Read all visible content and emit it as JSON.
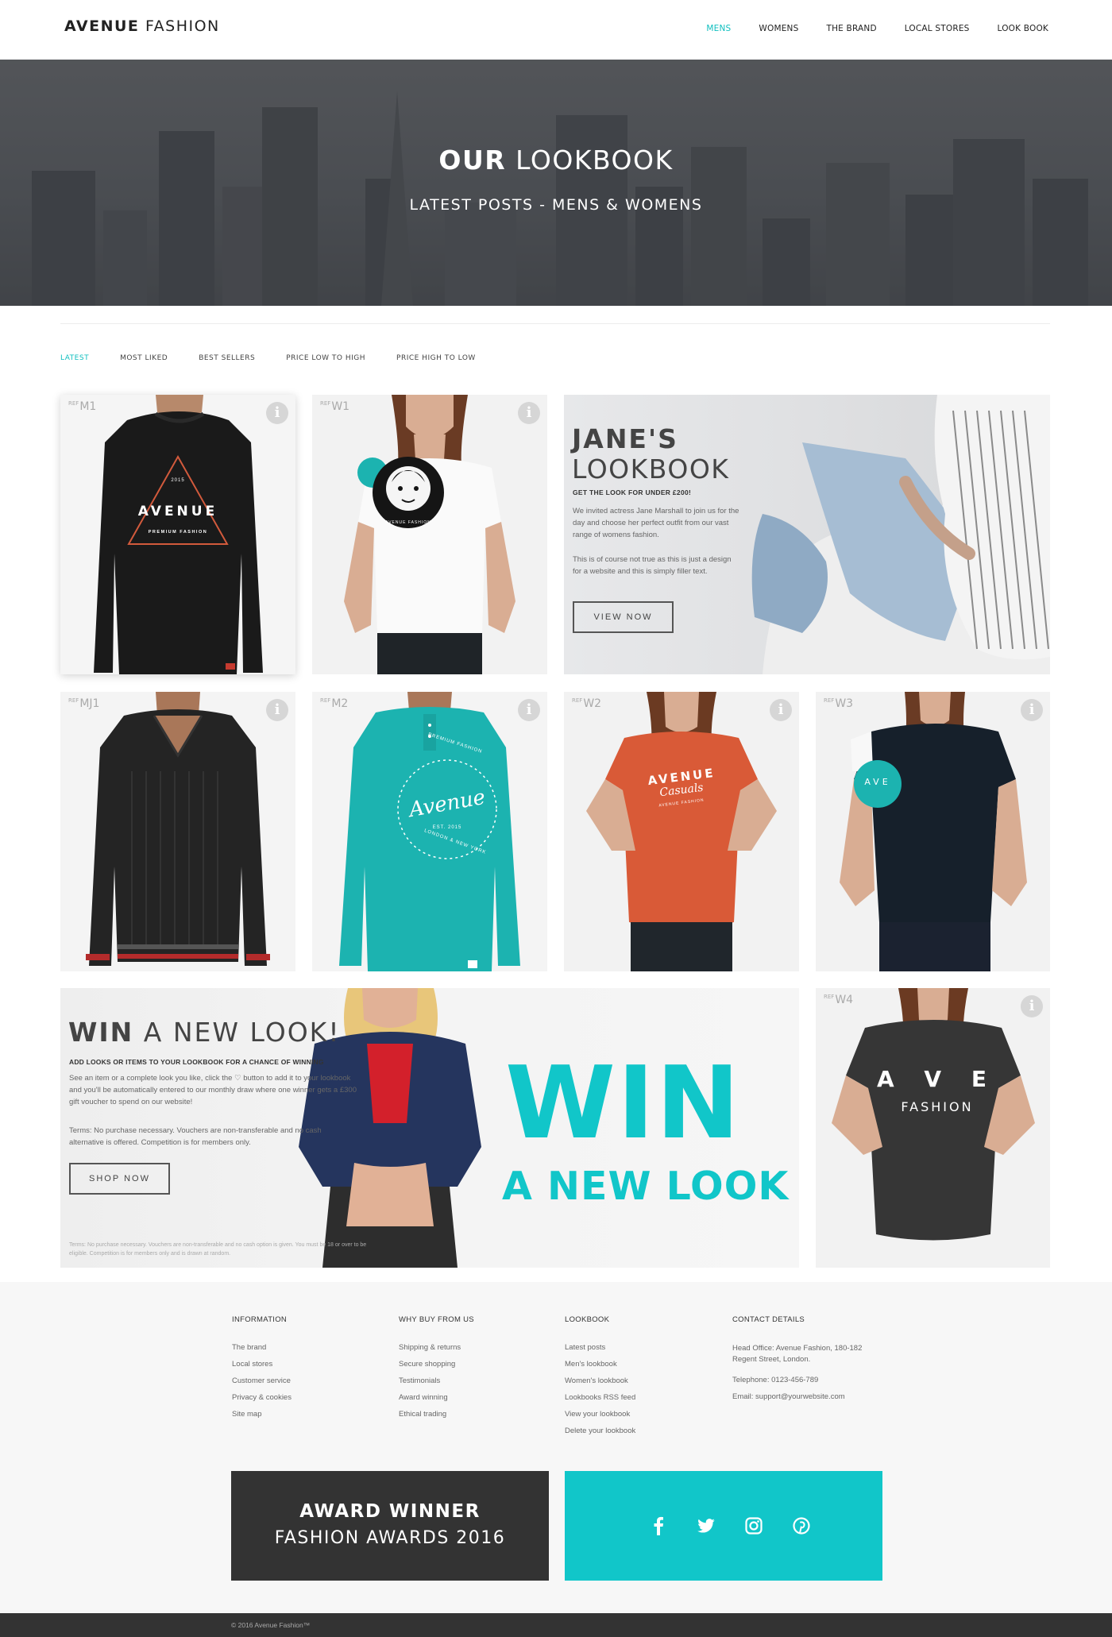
{
  "header": {
    "logo_bold": "AVENUE",
    "logo_light": "FASHION",
    "nav": [
      "MENS",
      "WOMENS",
      "THE BRAND",
      "LOCAL STORES",
      "LOOK BOOK"
    ]
  },
  "hero": {
    "title_bold": "OUR",
    "title_light": "LOOKBOOK",
    "subtitle": "LATEST POSTS - MENS & WOMENS"
  },
  "filters": [
    "LATEST",
    "MOST LIKED",
    "BEST SELLERS",
    "PRICE LOW TO HIGH",
    "PRICE HIGH TO LOW"
  ],
  "products": {
    "m1": {
      "ref_prefix": "REF",
      "ref": "M1",
      "print": "AVENUE",
      "print_year": "2015",
      "print_sub": "PREMIUM FASHION"
    },
    "w1": {
      "ref_prefix": "REF",
      "ref": "W1",
      "print_sub": "AVENUE FASHION"
    },
    "mj1": {
      "ref_prefix": "REF",
      "ref": "MJ1"
    },
    "m2": {
      "ref_prefix": "REF",
      "ref": "M2",
      "print_top": "PREMIUM FASHION",
      "print": "Avenue",
      "print_est": "EST. 2015",
      "print_bottom": "LONDON & NEW YORK"
    },
    "w2": {
      "ref_prefix": "REF",
      "ref": "W2",
      "print": "AVENUE",
      "print_script": "Casuals",
      "print_sub": "AVENUE FASHION"
    },
    "w3": {
      "ref_prefix": "REF",
      "ref": "W3",
      "print": "AVE"
    },
    "w4": {
      "ref_prefix": "REF",
      "ref": "W4",
      "print": "A V E",
      "print_sub": "FASHION"
    }
  },
  "info_icon_glyph": "i",
  "jane": {
    "title1": "JANE'S",
    "title2": "LOOKBOOK",
    "subtitle": "GET THE LOOK FOR UNDER £200!",
    "p1": "We invited actress Jane Marshall to join us for the day and choose her perfect outfit from our vast range of womens fashion.",
    "p2": "This is of course not true as this is just a design for a website and this is simply filler text.",
    "button": "VIEW NOW"
  },
  "win": {
    "title_bold": "WIN",
    "title_light": "A NEW LOOK!",
    "subtitle": "ADD LOOKS OR ITEMS TO YOUR LOOKBOOK FOR A CHANCE OF WINNING",
    "p1": "See an item or a complete look you like, click the ♡ button to add it to your lookbook and you'll be automatically entered to our monthly draw where one winner gets a £300 gift voucher to spend on our website!",
    "p2": "Terms: No purchase necessary. Vouchers are non-transferable and no cash alternative is offered. Competition is for members only.",
    "button": "SHOP NOW",
    "fine": "Terms: No purchase necessary. Vouchers are non-transferable and no cash option is given. You must be 18 or over to be eligible. Competition is for members only and is drawn at random.",
    "big1": "WIN",
    "big2": "A NEW LOOK"
  },
  "footer": {
    "information": {
      "heading": "INFORMATION",
      "links": [
        "The brand",
        "Local stores",
        "Customer service",
        "Privacy & cookies",
        "Site map"
      ]
    },
    "why": {
      "heading": "WHY BUY FROM US",
      "links": [
        "Shipping & returns",
        "Secure shopping",
        "Testimonials",
        "Award winning",
        "Ethical trading"
      ]
    },
    "lookbook": {
      "heading": "LOOKBOOK",
      "links": [
        "Latest posts",
        "Men's lookbook",
        "Women's lookbook",
        "Lookbooks RSS feed",
        "View your lookbook",
        "Delete your lookbook"
      ]
    },
    "contact": {
      "heading": "CONTACT DETAILS",
      "address": "Head Office: Avenue Fashion, 180-182 Regent Street, London.",
      "telephone": "Telephone: 0123-456-789",
      "email": "Email: support@yourwebsite.com"
    },
    "award_line1": "AWARD WINNER",
    "award_line2": "FASHION AWARDS 2016",
    "social_icons": [
      "facebook-icon",
      "twitter-icon",
      "instagram-icon",
      "pinterest-icon"
    ],
    "copyright": "© 2016 Avenue Fashion™"
  },
  "colors": {
    "accent": "#11c6c9",
    "dark": "#333333",
    "orange_shirt": "#d95a37",
    "teal_shirt": "#1cb3b0"
  }
}
